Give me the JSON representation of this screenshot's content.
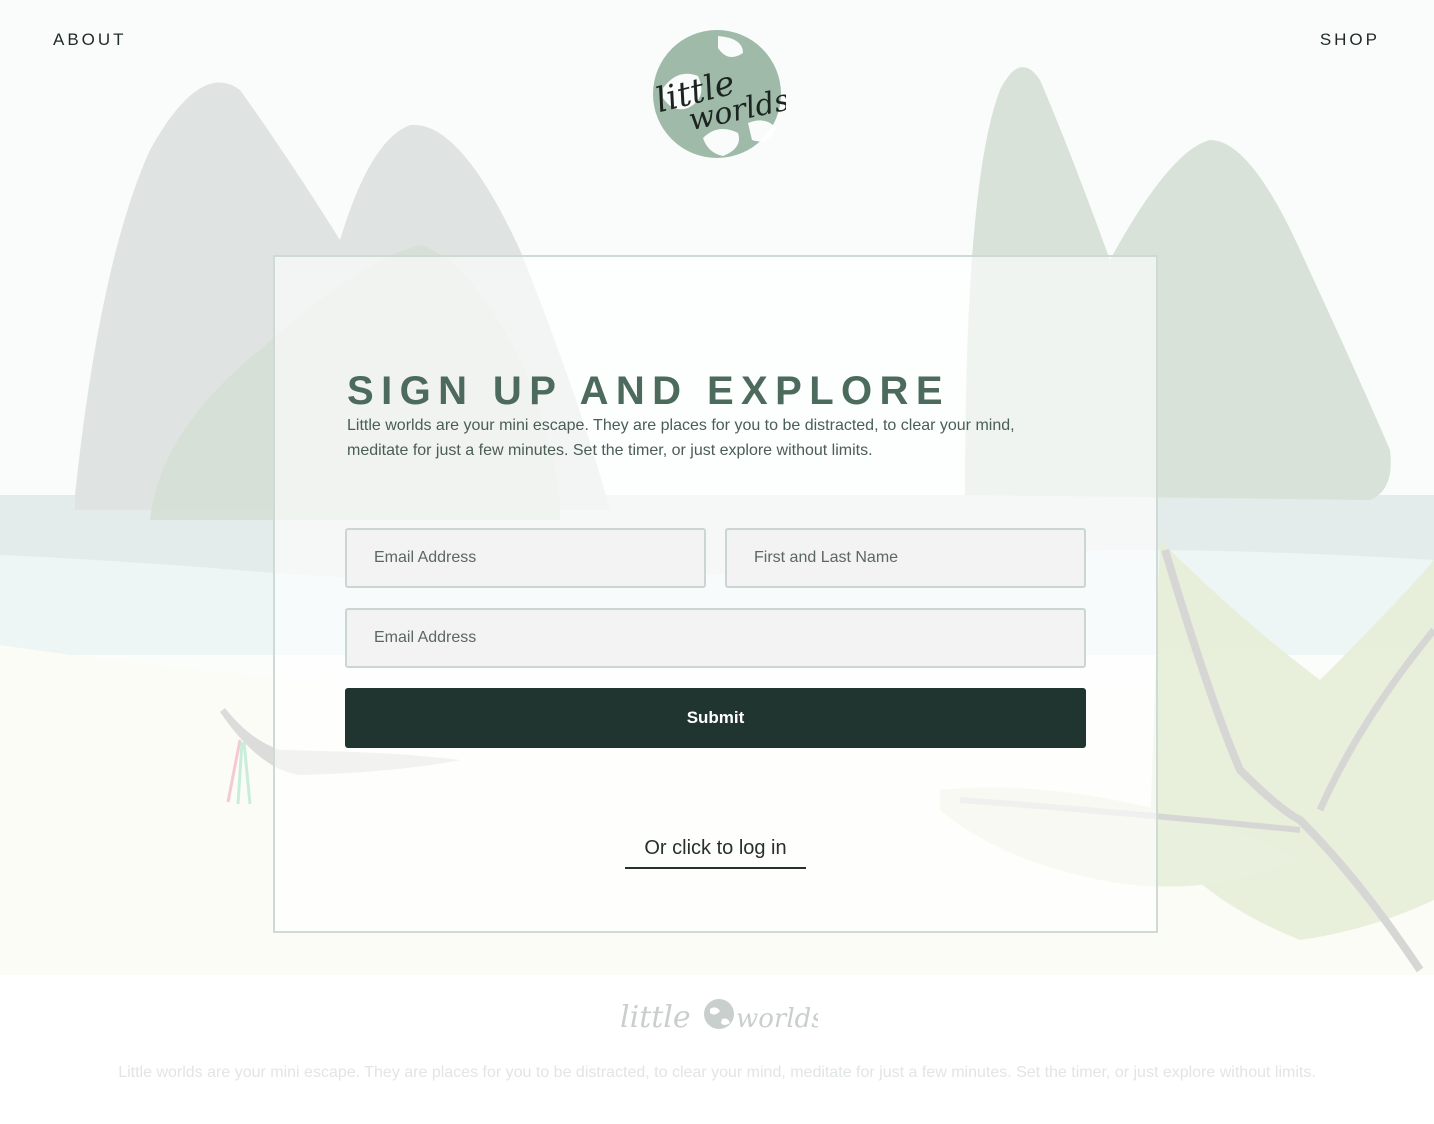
{
  "nav": {
    "about_label": "ABOUT",
    "shop_label": "SHOP"
  },
  "logo": {
    "line1": "little",
    "line2": "worlds"
  },
  "signup": {
    "title": "SIGN UP AND EXPLORE",
    "description": "Little worlds are your mini escape. They are places for you to be distracted, to clear your mind, meditate for just a few minutes. Set the timer, or just explore without limits.",
    "email_placeholder": "Email Address",
    "name_placeholder": "First and Last Name",
    "email2_placeholder": "Email Address",
    "submit_label": "Submit",
    "login_label": "Or click to log in"
  },
  "footer": {
    "logo_word1": "little",
    "logo_word2": "worlds",
    "text": "Little worlds are your mini escape. They are places for you to be distracted, to clear your mind, meditate for just a few minutes. Set the timer, or just explore without limits."
  },
  "colors": {
    "accent_green": "#4c6b5c",
    "button_dark": "#213530",
    "mountain": "#dde2e0",
    "leaf": "#e7efd9"
  }
}
